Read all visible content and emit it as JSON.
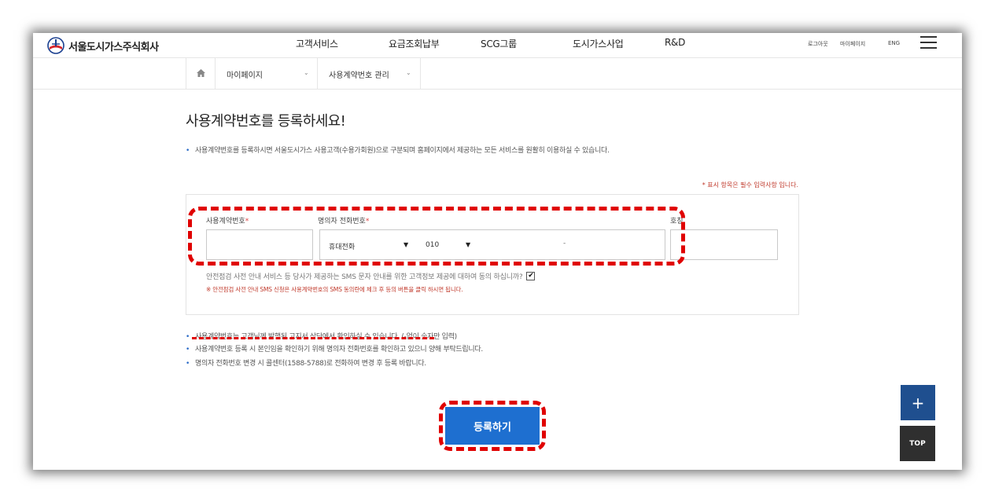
{
  "header": {
    "logo_text": "서울도시가스주식회사",
    "menu": [
      "고객서비스",
      "요금조회납부",
      "SCG그룹",
      "도시가스사업",
      "R&D"
    ],
    "util": {
      "logout": "로그아웃",
      "mypage": "마이페이지",
      "lang": "ENG"
    }
  },
  "breadcrumb": {
    "level1": "마이페이지",
    "level2": "사용계약번호 관리"
  },
  "page": {
    "title": "사용계약번호를 등록하세요!",
    "intro": "사용계약번호를 등록하시면 서울도시가스 사용고객(수용가회원)으로 구분되며 홈페이지에서 제공하는 모든 서비스를 원활히 이용하실 수 있습니다.",
    "required_note": "* 표시 항목은 필수 입력사항 입니다."
  },
  "form": {
    "contract_label": "사용계약번호",
    "phone_label": "명의자 전화번호",
    "req_mark": "*",
    "extra_label": "호칭",
    "phone_type": "휴대전화",
    "phone_prefix": "010",
    "phone_dash": "-",
    "consent_text": "안전점검 사전 안내 서비스 등 당사가 제공하는 SMS 문자 안내를 위한 고객정보 제공에 대하여 동의 하십니까?",
    "consent_checked": "✔",
    "consent_note": "※ 안전점검 사전 안내 SMS 신청은 사용계약번호의 SMS 동의란에 체크 후 등의 버튼을 클릭 하시면 됩니다."
  },
  "notes": [
    "사용계약번호는 고객님께 발행된 고지서 상단에서 확인하실 수 있습니다. (-없이 숫자만 입력)",
    "사용계약번호 등록 시 본인임을 확인하기 위해 명의자 전화번호를 확인하고 있으니 양해 부탁드립니다.",
    "명의자 전화번호 변경 시 콜센터(1588-5788)로 전화하여 변경 후 등록 바랍니다."
  ],
  "buttons": {
    "submit": "등록하기",
    "plus": "+",
    "top": "TOP"
  },
  "colors": {
    "accent": "#1e6fd0",
    "highlight": "#e00000",
    "required": "#c0392b"
  }
}
